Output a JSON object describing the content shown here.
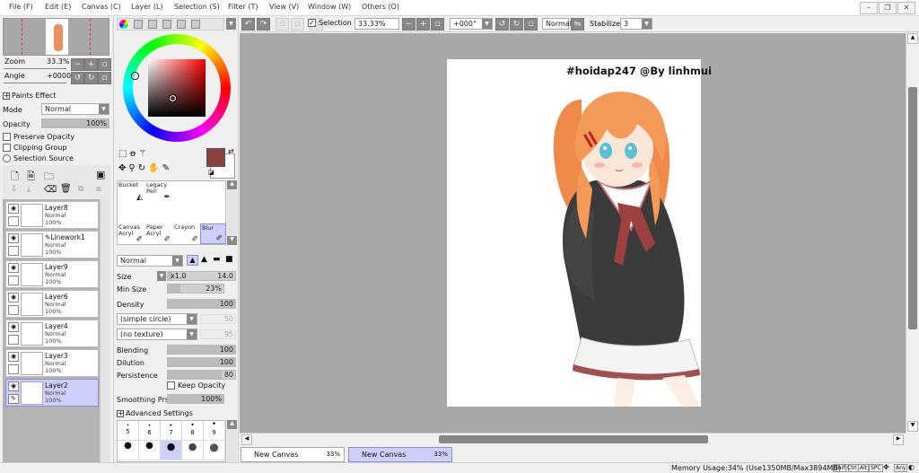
{
  "menu": [
    {
      "label": "File (F)",
      "name": "menu-file"
    },
    {
      "label": "Edit (E)",
      "name": "menu-edit"
    },
    {
      "label": "Canvas (C)",
      "name": "menu-canvas"
    },
    {
      "label": "Layer (L)",
      "name": "menu-layer"
    },
    {
      "label": "Selection (S)",
      "name": "menu-selection"
    },
    {
      "label": "Filter (T)",
      "name": "menu-filter"
    },
    {
      "label": "View (V)",
      "name": "menu-view"
    },
    {
      "label": "Window (W)",
      "name": "menu-window"
    },
    {
      "label": "Others (O)",
      "name": "menu-others"
    }
  ],
  "navigator": {
    "zoom_label": "Zoom",
    "zoom_value": "33.3%",
    "angle_label": "Angle",
    "angle_value": "+0000"
  },
  "layer_props": {
    "paints_effect": "Paints Effect",
    "mode_label": "Mode",
    "mode_value": "Normal",
    "opacity_label": "Opacity",
    "opacity_value": "100%",
    "preserve_opacity": "Preserve Opacity",
    "clipping_group": "Clipping Group",
    "selection_source": "Selection Source"
  },
  "layers": [
    {
      "name": "Layer8",
      "mode": "Normal",
      "opacity": "100%",
      "selected": false
    },
    {
      "name": "Linework1",
      "mode": "Normal",
      "opacity": "100%",
      "selected": false
    },
    {
      "name": "Layer9",
      "mode": "Normal",
      "opacity": "100%",
      "selected": false
    },
    {
      "name": "Layer6",
      "mode": "Normal",
      "opacity": "100%",
      "selected": false
    },
    {
      "name": "Layer4",
      "mode": "Normal",
      "opacity": "100%",
      "selected": false
    },
    {
      "name": "Layer3",
      "mode": "Normal",
      "opacity": "100%",
      "selected": false
    },
    {
      "name": "Layer2",
      "mode": "Normal",
      "opacity": "100%",
      "selected": true
    }
  ],
  "colors": {
    "primary": "#8b3f3f",
    "secondary": "#ffffff",
    "accent_select": "#cfcffb"
  },
  "tools": [
    {
      "line1": "Bucket",
      "line2": ""
    },
    {
      "line1": "Legacy",
      "line2": "Pen"
    },
    {
      "line1": "Canvas",
      "line2": "Acryl"
    },
    {
      "line1": "Paper",
      "line2": "Acryl"
    },
    {
      "line1": "Crayon",
      "line2": ""
    },
    {
      "line1": "Blur",
      "line2": ""
    }
  ],
  "brush": {
    "blend_mode": "Normal",
    "size_label": "Size",
    "size_mult": "x1.0",
    "size_value": "14.0",
    "minsize_label": "Min Size",
    "minsize_value": "23%",
    "density_label": "Density",
    "density_value": "100",
    "shape": "(simple circle)",
    "shape_value": "50",
    "texture": "(no texture)",
    "texture_value": "95",
    "blending_label": "Blending",
    "blending_value": "100",
    "dilution_label": "Dilution",
    "dilution_value": "100",
    "persistence_label": "Persistence",
    "persistence_value": "80",
    "keep_opacity": "Keep Opacity",
    "smoothing_label": "Smoothing Prs",
    "smoothing_value": "100%",
    "advanced": "Advanced Settings",
    "sizes_row1": [
      "5",
      "6",
      "7",
      "8",
      "9"
    ]
  },
  "toolbar": {
    "selection": "Selection",
    "zoom": "33.33%",
    "angle": "+000°",
    "mode": "Normal",
    "stabilizer_label": "Stabilizer",
    "stabilizer_value": "3"
  },
  "canvas_text": "#hoidap247 @By linhmui",
  "tabs": [
    {
      "label": "New Canvas",
      "pct": "33%",
      "selected": false
    },
    {
      "label": "New Canvas",
      "pct": "33%",
      "selected": true
    }
  ],
  "status": {
    "memory": "Memory Usage:34% (Use1350MB/Max3894MB)",
    "keys": [
      "Shift",
      "Ctrl",
      "Alt",
      "SPC"
    ],
    "any": "Any"
  }
}
